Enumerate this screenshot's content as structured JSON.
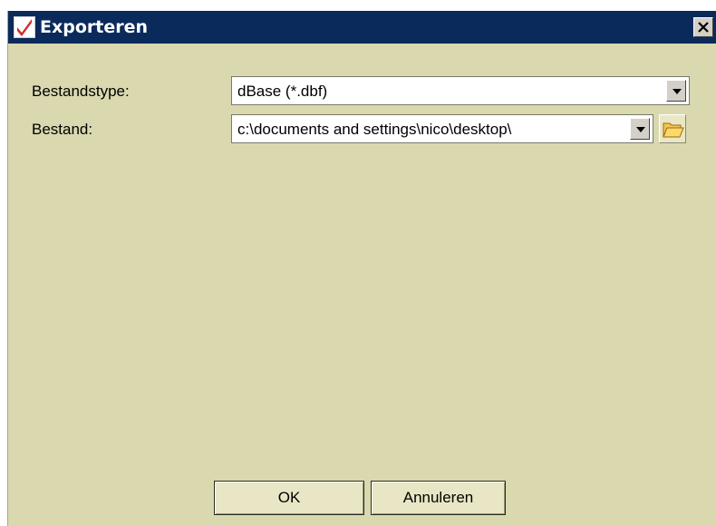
{
  "window": {
    "title": "Exporteren",
    "app_icon": "checkmark-icon",
    "close_icon": "close-icon"
  },
  "form": {
    "file_type": {
      "label": "Bestandstype:",
      "value": "dBase (*.dbf)"
    },
    "file": {
      "label": "Bestand:",
      "value": "c:\\documents and settings\\nico\\desktop\\"
    }
  },
  "buttons": {
    "ok": "OK",
    "cancel": "Annuleren"
  },
  "colors": {
    "titlebar": "#0b2a5c",
    "dialog_background": "#d9d8af",
    "check_mark": "#d42a2a"
  }
}
